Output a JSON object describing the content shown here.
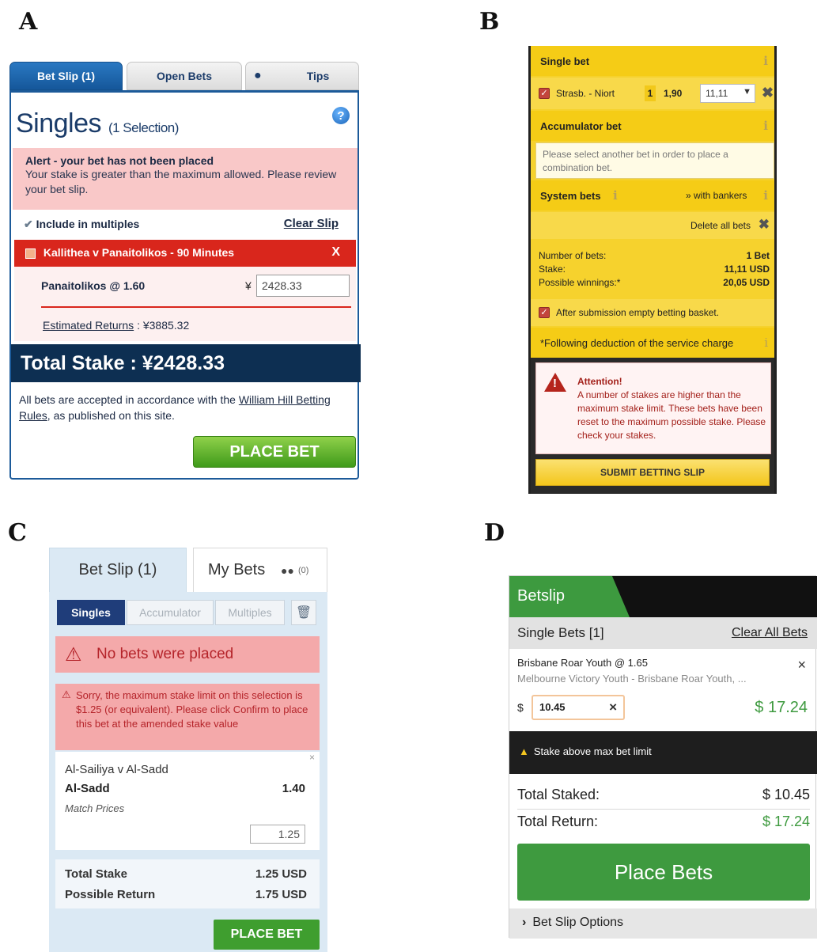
{
  "labels": {
    "a": "A",
    "b": "B",
    "c": "C",
    "d": "D"
  },
  "panel_a": {
    "tabs": [
      "Bet Slip (1)",
      "Open Bets",
      "Tips"
    ],
    "title": "Singles",
    "title_sub": "(1 Selection)",
    "help_icon": "?",
    "alert_heading": "Alert - your bet has not been placed",
    "alert_text": "Your stake is greater than the maximum allowed. Please review your bet slip.",
    "include_multiples": "Include in multiples",
    "clear_slip": "Clear Slip",
    "selection_bar": "Kallithea v Panaitolikos - 90 Minutes",
    "selection_close": "X",
    "selection_name": "Panaitolikos @ 1.60",
    "currency": "¥",
    "stake_value": "2428.33",
    "est_label": "Estimated Returns",
    "est_value": ": ¥3885.32",
    "total_stake": "Total Stake : ¥2428.33",
    "rules_text_1": "All bets are accepted in accordance with the ",
    "rules_link": "William Hill Betting Rules",
    "rules_text_2": ", as published on this site.",
    "place_bet": "PLACE BET"
  },
  "panel_b": {
    "single_bet": "Single bet",
    "info_icon": "i",
    "selection": "Strasb. - Niort",
    "pick": "1",
    "odds": "1,90",
    "stake": "11,11",
    "accumulator_bet": "Accumulator bet",
    "accumulator_note": "Please select another bet in order to place a combination bet.",
    "system_bets": "System bets",
    "with_bankers": "» with bankers",
    "delete_all": "Delete all bets",
    "number_of_bets_label": "Number of bets:",
    "number_of_bets_value": "1 Bet",
    "stake_label": "Stake:",
    "stake_value": "11,11 USD",
    "winnings_label": "Possible winnings:*",
    "winnings_value": "20,05 USD",
    "after_submission": "After submission empty betting basket.",
    "service_note": "*Following deduction of the service charge",
    "attention_heading": "Attention!",
    "attention_text": "A number of stakes are higher than the maximum stake limit. These bets have been reset to the maximum possible stake. Please check your stakes.",
    "submit": "SUBMIT BETTING SLIP"
  },
  "panel_c": {
    "tab_betslip": "Bet Slip (1)",
    "tab_mybets": "My Bets",
    "mybets_count": "(0)",
    "subtabs": [
      "Singles",
      "Accumulator",
      "Multiples"
    ],
    "no_bets": "No bets were placed",
    "sorry_text": "Sorry, the maximum stake limit on this selection is $1.25 (or equivalent). Please click Confirm to place this bet at the amended stake value",
    "close_icon": "×",
    "match": "Al-Sailiya v Al-Sadd",
    "pick": "Al-Sadd",
    "odds": "1.40",
    "market": "Match Prices",
    "stake": "1.25",
    "total_stake_label": "Total Stake",
    "total_stake_value": "1.25 USD",
    "possible_return_label": "Possible Return",
    "possible_return_value": "1.75 USD",
    "place_bet": "PLACE BET"
  },
  "panel_d": {
    "tab": "Betslip",
    "single_bets": "Single Bets [1]",
    "clear_all": "Clear All Bets",
    "selection": "Brisbane Roar Youth @ 1.65",
    "event": "Melbourne Victory Youth - Brisbane Roar Youth, ...",
    "close_icon": "×",
    "currency": "$",
    "stake": "10.45",
    "potential_return": "$ 17.24",
    "warning": "Stake above max bet limit",
    "total_staked_label": "Total Staked:",
    "total_staked_value": "$ 10.45",
    "total_return_label": "Total Return:",
    "total_return_value": "$ 17.24",
    "place_bets": "Place Bets",
    "options": "Bet Slip Options"
  }
}
